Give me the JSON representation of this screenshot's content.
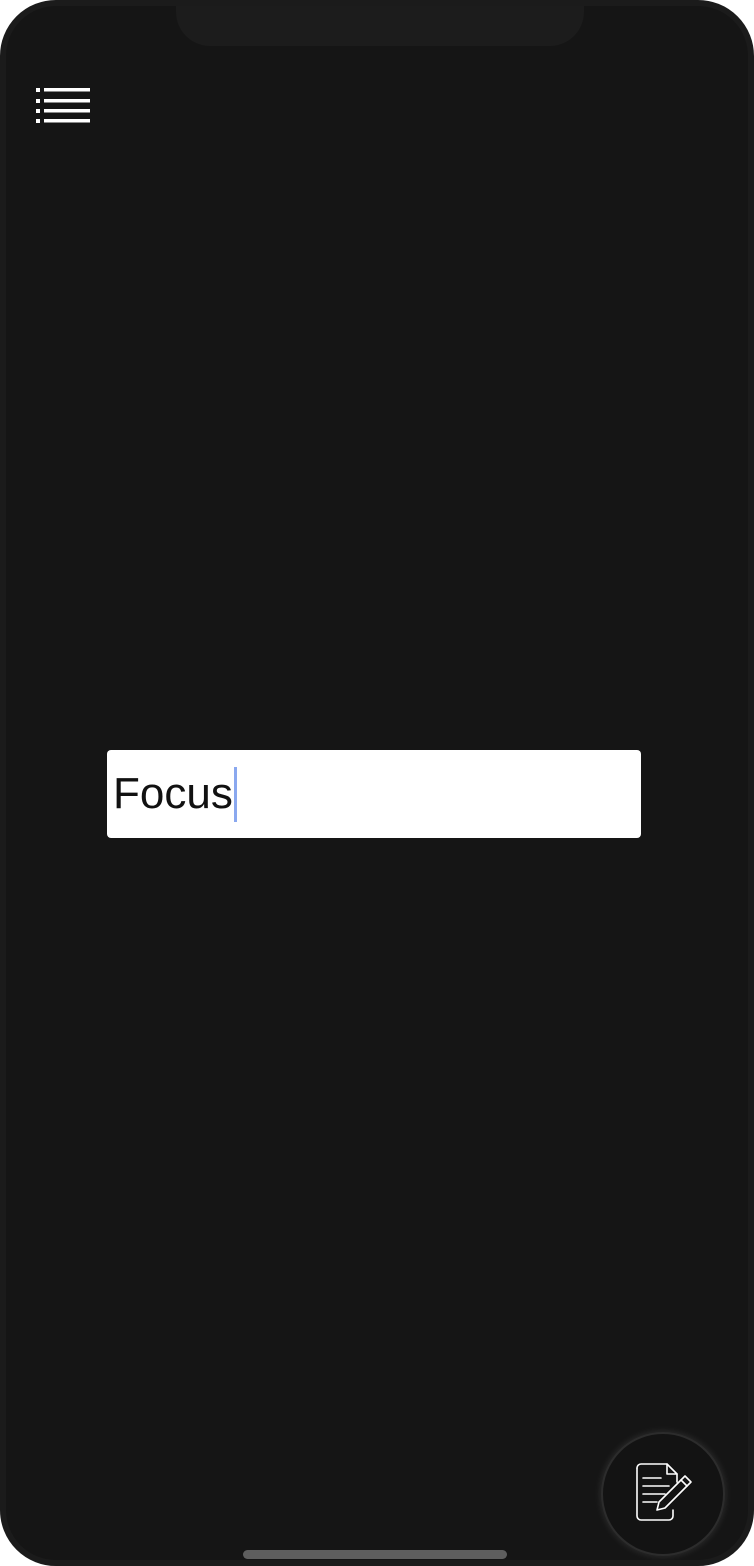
{
  "text_field": {
    "value": "Focus"
  },
  "icons": {
    "menu": "list-menu-icon",
    "compose": "note-edit-icon"
  },
  "colors": {
    "background": "#151515",
    "field_background": "#ffffff",
    "field_text": "#111111",
    "caret": "#8aa8ef",
    "icon_stroke": "#ffffff"
  }
}
